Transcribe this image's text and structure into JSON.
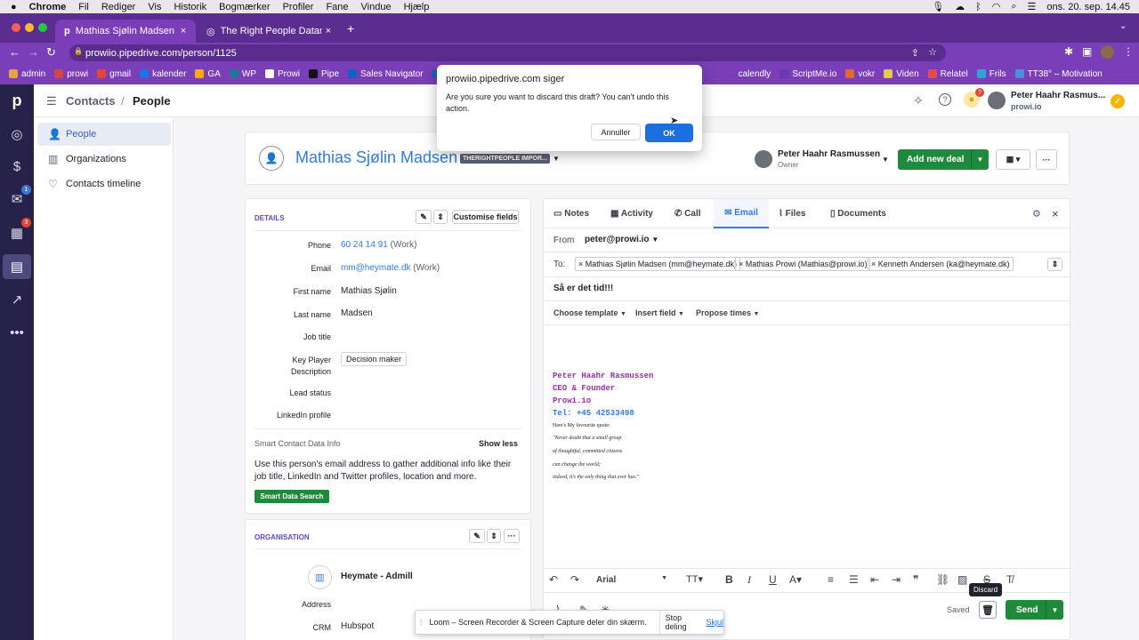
{
  "menubar": {
    "app": "Chrome",
    "items": [
      "Fil",
      "Rediger",
      "Vis",
      "Historik",
      "Bogmærker",
      "Profiler",
      "Fane",
      "Vindue",
      "Hjælp"
    ],
    "clock": "ons. 20. sep.  14.45"
  },
  "browser": {
    "tabs": [
      {
        "title": "Mathias Sjølin Madsen - conta"
      },
      {
        "title": "The Right People Datamanager"
      }
    ],
    "url": "prowiio.pipedrive.com/person/1125",
    "bookmarks": [
      "admin",
      "prowi",
      "gmail",
      "kalender",
      "GA",
      "WP",
      "Prowi",
      "Pipe",
      "Sales Navigator",
      "calendly",
      "ScriptMe.io",
      "vokr",
      "Viden",
      "Relatel",
      "Frils",
      "TT38° – Motivation"
    ],
    "bookmark_colors": [
      "#e8a33a",
      "#d64545",
      "#ea4335",
      "#1a73e8",
      "#f9ab00",
      "#21759b",
      "#ffffff",
      "#111111",
      "#0a66c2",
      "#006bff",
      "#6a3ab2",
      "#e06a2c",
      "#e8c84a",
      "#e84a4a",
      "#2aa5d8",
      "#4a90d8"
    ]
  },
  "dialog": {
    "title": "prowiio.pipedrive.com siger",
    "message": "Are you sure you want to discard this draft? You can't undo this action.",
    "cancel": "Annuller",
    "ok": "OK"
  },
  "nav": {
    "badges": {
      "mail": "1",
      "activities": "3"
    }
  },
  "header": {
    "breadcrumb_parent": "Contacts",
    "separator": "/",
    "breadcrumb_current": "People",
    "user_name": "Peter Haahr Rasmus...",
    "user_company": "prowi.io",
    "notify_badge": "?"
  },
  "sidebar": {
    "items": [
      {
        "label": "People",
        "icon": "person-icon"
      },
      {
        "label": "Organizations",
        "icon": "building-icon"
      },
      {
        "label": "Contacts timeline",
        "icon": "heart-icon"
      }
    ]
  },
  "person": {
    "name": "Mathias Sjølin Madsen",
    "tag": "THERIGHTPEOPLE IMPOR...",
    "owner_name": "Peter Haahr Rasmussen",
    "owner_label": "Owner",
    "add_deal": "Add new deal"
  },
  "details": {
    "title": "DETAILS",
    "customise": "Customise fields",
    "fields": [
      {
        "label": "Phone",
        "value": "60 24 14 91",
        "note": "(Work)"
      },
      {
        "label": "Email",
        "value": "mm@heymate.dk",
        "note": "(Work)"
      },
      {
        "label": "First name",
        "value": "Mathias Sjølin"
      },
      {
        "label": "Last name",
        "value": "Madsen"
      },
      {
        "label": "Job title",
        "value": ""
      },
      {
        "label": "Key Player Description",
        "value": "Decision maker"
      },
      {
        "label": "Lead status",
        "value": ""
      },
      {
        "label": "LinkedIn profile",
        "value": ""
      }
    ],
    "smart_title": "Smart Contact Data Info",
    "show_less": "Show less",
    "smart_text": "Use this person's email address to gather additional info like their job title, LinkedIn and Twitter profiles, location and more.",
    "smart_button": "Smart Data Search"
  },
  "organisation": {
    "title": "ORGANISATION",
    "name": "Heymate - Admill",
    "address_label": "Address",
    "crm_label": "CRM",
    "crm_value": "Hubspot"
  },
  "composer": {
    "tabs": [
      "Notes",
      "Activity",
      "Call",
      "Email",
      "Files",
      "Documents"
    ],
    "active_tab": "Email",
    "from_label": "From",
    "from_value": "peter@prowi.io",
    "to_label": "To:",
    "recipients": [
      "Mathias Sjølin Madsen (mm@heymate.dk)",
      "Mathias Prowi (Mathias@prowi.io)",
      "Kenneth Andersen (ka@heymate.dk)"
    ],
    "subject": "Så er det tid!!!",
    "toolbar": [
      "Choose template",
      "Insert field",
      "Propose times"
    ],
    "signature": {
      "name": "Peter Haahr Rasmussen",
      "role": "CEO & Founder",
      "company": "Prowi.io",
      "tel": "Tel: +45 42533498",
      "quote_intro": "Here's My favourite quote:",
      "quote_lines": [
        "\"Never doubt that a small group",
        "of thoughtful, committed citizens",
        "can change the world;",
        "indeed, it's the only thing that ever has.\""
      ]
    },
    "font": "Arial",
    "tooltip": "Discard",
    "saved": "Saved",
    "send": "Send"
  },
  "loom": {
    "text": "Loom – Screen Recorder & Screen Capture deler din skærm.",
    "stop": "Stop deling",
    "hide": "Skjul"
  },
  "colors": {
    "nav_bg": "#26224a",
    "browser_purple": "#7a3fb8",
    "green": "#1f8a3c",
    "link_blue": "#317ae2",
    "sig_purple": "#9b2da8",
    "dialog_blue": "#1c6fdf"
  }
}
